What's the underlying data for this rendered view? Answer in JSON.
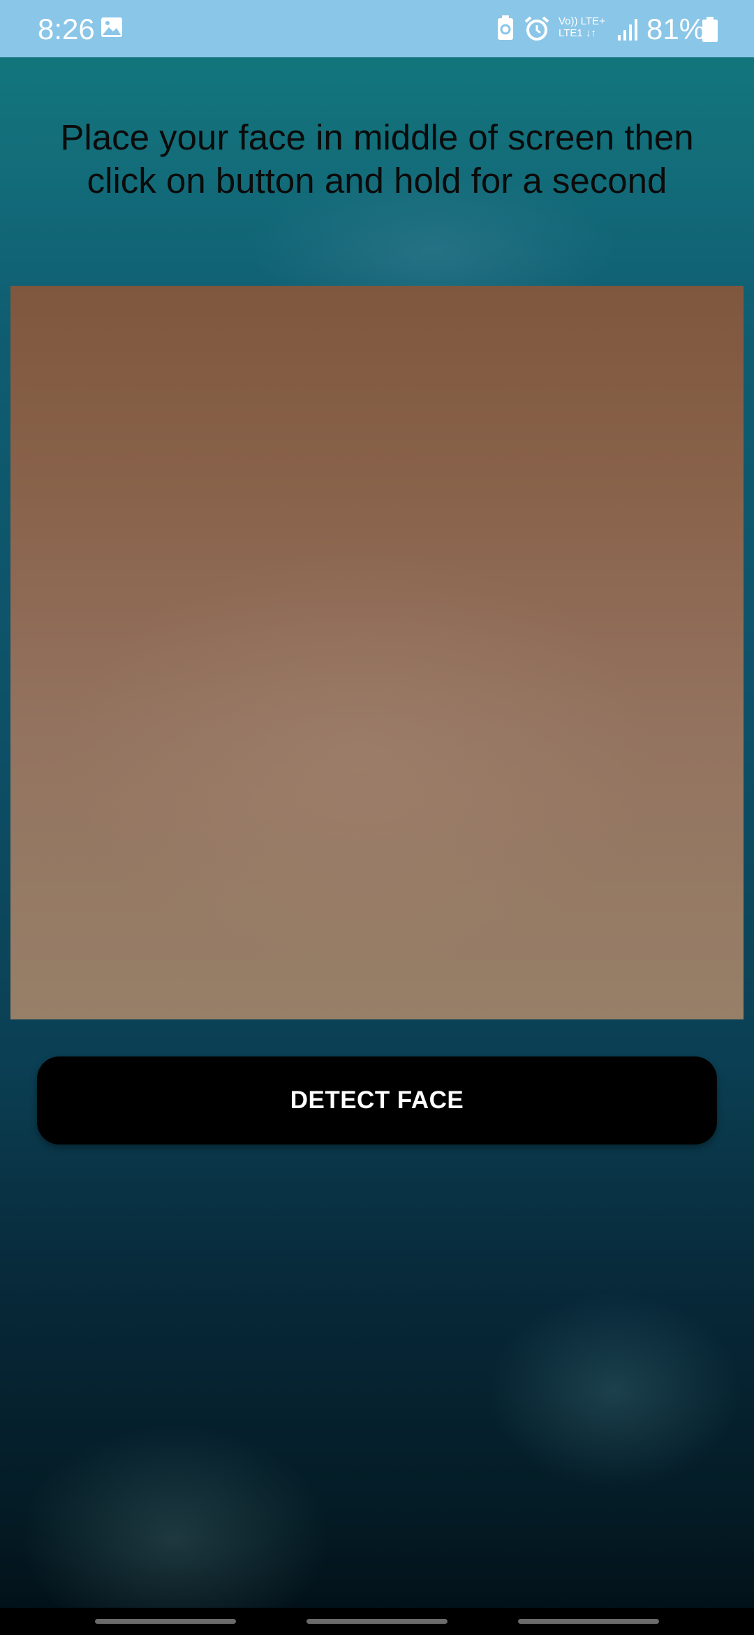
{
  "status_bar": {
    "time": "8:26",
    "network_label_top": "Vo)) LTE+",
    "network_label_bottom": "LTE1 ↓↑",
    "battery_percent": "81%",
    "icons": [
      "gallery-icon",
      "battery-saver-icon",
      "alarm-icon",
      "signal-icon",
      "battery-icon"
    ],
    "background_color": "#8ac6e8"
  },
  "instruction": {
    "text": "Place your face in middle of screen then click on button and hold for a second"
  },
  "detect_button": {
    "label": "DETECT FACE"
  },
  "navigation_bar": {
    "items": [
      "recent-apps-handle",
      "home-handle",
      "back-handle"
    ]
  },
  "colors": {
    "button_background": "#000000",
    "button_text": "#ffffff",
    "instruction_text": "#0b0b0b"
  }
}
